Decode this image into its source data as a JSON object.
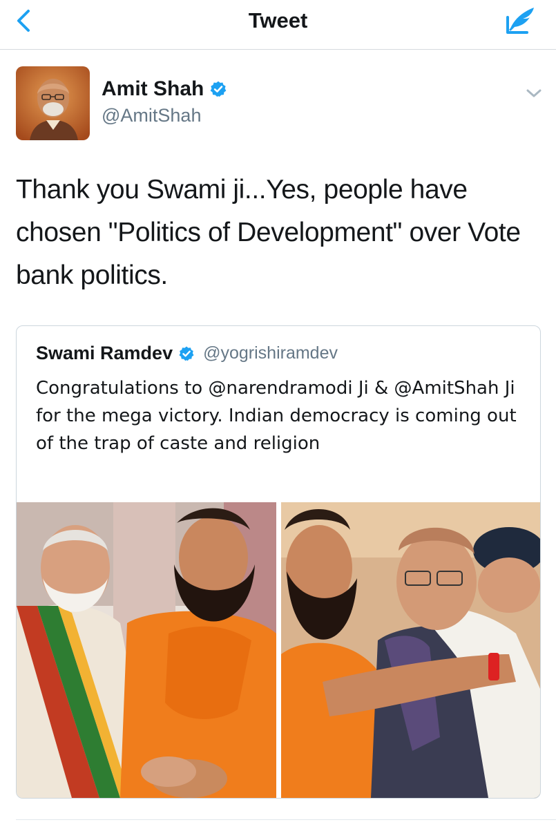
{
  "nav": {
    "title": "Tweet",
    "back_icon": "chevron-left-icon",
    "compose_icon": "compose-tweet-icon",
    "accent": "#1da1f2"
  },
  "tweet": {
    "author_name": "Amit Shah",
    "author_handle": "@AmitShah",
    "verified": true,
    "text": "Thank you Swami ji...Yes, people have chosen \"Politics of Development\" over Vote bank politics.",
    "menu_icon": "chevron-down-icon"
  },
  "quoted_tweet": {
    "author_name": "Swami Ramdev",
    "author_handle": "@yogrishiramdev",
    "verified": true,
    "text": "Congratulations to @narendramodi Ji & @AmitShah Ji for the mega victory. Indian democracy is coming out of the trap of caste and religion",
    "photo_count": 2
  },
  "colors": {
    "verified_badge": "#1da1f2",
    "secondary_text": "#657786",
    "border": "#ccd6dd"
  }
}
